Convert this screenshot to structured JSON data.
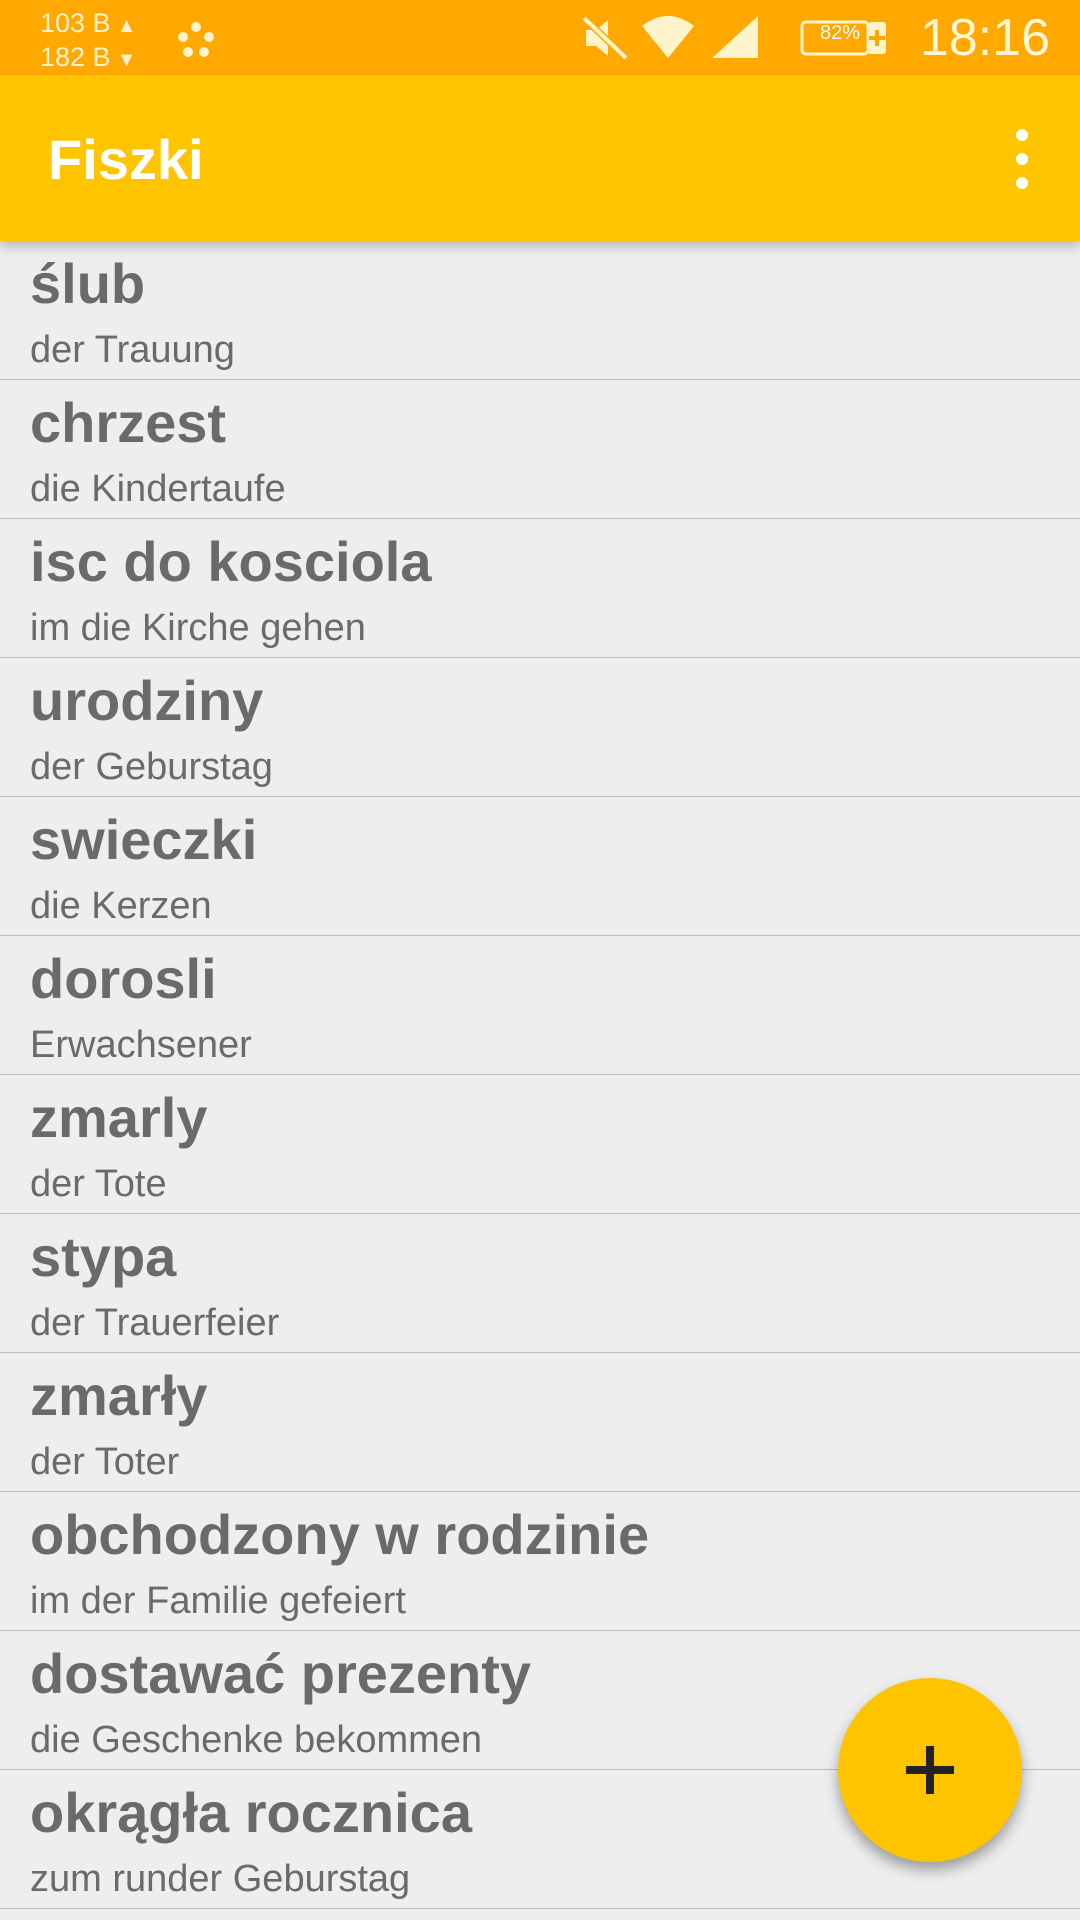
{
  "status_bar": {
    "upload_speed": "103 B",
    "download_speed": "182 B",
    "battery_percent": "82%",
    "time": "18:16",
    "icons": [
      "network-speed-indicator",
      "dots-icon",
      "mute-icon",
      "wifi-icon",
      "signal-icon",
      "battery-icon"
    ]
  },
  "app_bar": {
    "title": "Fiszki",
    "overflow_icon": "more-vert-icon"
  },
  "flashcards": [
    {
      "word": "ślub",
      "translation": "der Trauung"
    },
    {
      "word": "chrzest",
      "translation": "die Kindertaufe"
    },
    {
      "word": "isc do kosciola",
      "translation": "im die Kirche gehen"
    },
    {
      "word": "urodziny",
      "translation": "der Geburstag"
    },
    {
      "word": "swieczki",
      "translation": "die Kerzen"
    },
    {
      "word": "dorosli",
      "translation": "Erwachsener"
    },
    {
      "word": "zmarly",
      "translation": "der Tote"
    },
    {
      "word": "stypa",
      "translation": "der Trauerfeier"
    },
    {
      "word": "zmarły",
      "translation": "der Toter"
    },
    {
      "word": "obchodzony w rodzinie",
      "translation": "im der Familie gefeiert"
    },
    {
      "word": "dostawać prezenty",
      "translation": "die Geschenke bekommen"
    },
    {
      "word": "okrągła rocznica",
      "translation": "zum runder Geburstag"
    }
  ],
  "fab": {
    "icon": "add-icon"
  },
  "colors": {
    "status_bar": "#ffa800",
    "app_bar": "#ffc400",
    "background": "#eeeeee",
    "text": "#6a6a6a",
    "fab": "#ffc400"
  }
}
